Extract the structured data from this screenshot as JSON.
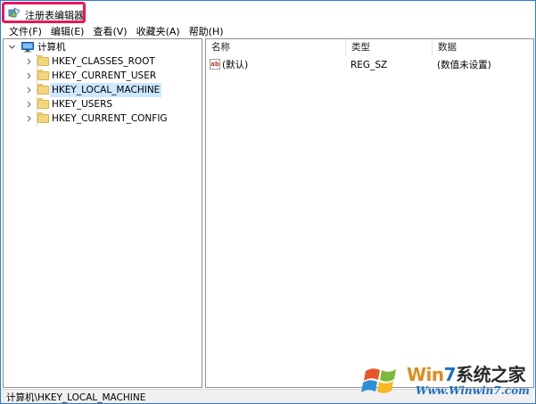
{
  "window": {
    "title": "注册表编辑器",
    "icon": "regedit-icon",
    "highlight_color": "#e8185a"
  },
  "menu": [
    {
      "label": "文件(F)"
    },
    {
      "label": "编辑(E)"
    },
    {
      "label": "查看(V)"
    },
    {
      "label": "收藏夹(A)"
    },
    {
      "label": "帮助(H)"
    }
  ],
  "tree": {
    "root": {
      "label": "计算机",
      "icon": "computer-icon",
      "expanded": true
    },
    "children": [
      {
        "label": "HKEY_CLASSES_ROOT",
        "icon": "folder-icon",
        "selected": false
      },
      {
        "label": "HKEY_CURRENT_USER",
        "icon": "folder-icon",
        "selected": false
      },
      {
        "label": "HKEY_LOCAL_MACHINE",
        "icon": "folder-icon",
        "selected": true
      },
      {
        "label": "HKEY_USERS",
        "icon": "folder-icon",
        "selected": false
      },
      {
        "label": "HKEY_CURRENT_CONFIG",
        "icon": "folder-icon",
        "selected": false
      }
    ],
    "selection_color": "#cce8ff"
  },
  "list": {
    "columns": [
      {
        "label": "名称"
      },
      {
        "label": "类型"
      },
      {
        "label": "数据"
      }
    ],
    "rows": [
      {
        "name": "(默认)",
        "type": "REG_SZ",
        "data": "(数值未设置)",
        "icon": "string-value-icon",
        "icon_text": "ab"
      }
    ]
  },
  "status": {
    "path": "计算机\\HKEY_LOCAL_MACHINE"
  },
  "watermark": {
    "brand_part1": "Win",
    "brand_part2": "7",
    "brand_part3": "系统之家",
    "url": "Www.Winwin7.com"
  }
}
